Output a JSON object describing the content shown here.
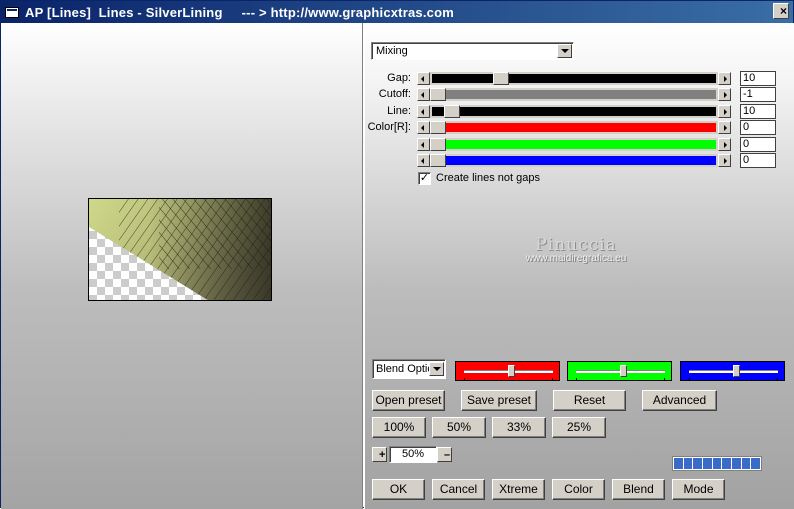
{
  "window": {
    "title": "AP [Lines]  Lines - SilverLining     --- > http://www.graphicxtras.com",
    "close_glyph": "×"
  },
  "mode_select": {
    "value": "Mixing"
  },
  "sliders": [
    {
      "label": "Gap:",
      "value": "10",
      "fill_color": "#000000",
      "level": 0.23,
      "track_color": "#d4d0c8"
    },
    {
      "label": "Cutoff:",
      "value": "-1",
      "fill_color": "#808080",
      "level": 0.0,
      "track_color": "#d4d0c8"
    },
    {
      "label": "Line:",
      "value": "10",
      "fill_color": "#000000",
      "level": 0.05,
      "track_color": "#d4d0c8"
    },
    {
      "label": "Color[R]:",
      "value": "0",
      "fill_color": "#ff0000",
      "level": 0.0,
      "track_color": "#d4d0c8"
    },
    {
      "label": "",
      "value": "0",
      "fill_color": "#00ff00",
      "level": 0.0,
      "track_color": "#d4d0c8"
    },
    {
      "label": "",
      "value": "0",
      "fill_color": "#0000ff",
      "level": 0.0,
      "track_color": "#d4d0c8"
    }
  ],
  "checkbox": {
    "label": "Create lines not gaps",
    "checked": true,
    "mark": "✓"
  },
  "watermark": {
    "line1": "Pinuccia",
    "line2": "www.maidiregrafica.eu"
  },
  "blend_select": {
    "value": "Blend Options"
  },
  "color_sliders": [
    {
      "color": "#ff0000",
      "level": 0.5
    },
    {
      "color": "#00ff00",
      "level": 0.5
    },
    {
      "color": "#0000ff",
      "level": 0.5
    }
  ],
  "buttons": {
    "open_preset": "Open preset",
    "save_preset": "Save preset",
    "reset": "Reset",
    "advanced": "Advanced",
    "zoom_100": "100%",
    "zoom_50": "50%",
    "zoom_33": "33%",
    "zoom_25": "25%",
    "ok": "OK",
    "cancel": "Cancel",
    "xtreme": "Xtreme",
    "color": "Color",
    "blend": "Blend",
    "mode": "Mode"
  },
  "zoom": {
    "plus": "+",
    "minus": "–",
    "value": "50%"
  },
  "progress_segments": 9,
  "colors": {
    "title_start": "#0a246a",
    "title_end": "#3a6ea5",
    "progress": "#3a6bc9"
  }
}
